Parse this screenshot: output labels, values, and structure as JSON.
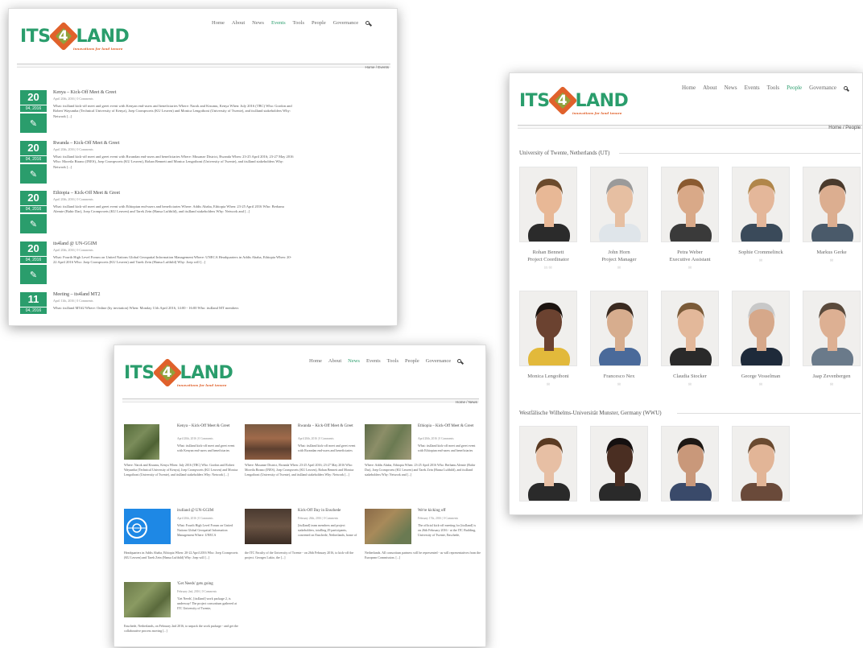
{
  "colors": {
    "brand_green": "#2a9d6c",
    "brand_orange": "#e0612b",
    "date_box": "#2a9d6c"
  },
  "brand": {
    "its": "ITS",
    "four": "4",
    "land": "LAND",
    "tagline": "innovations for land tenure"
  },
  "events_window": {
    "nav": [
      "Home",
      "About",
      "News",
      "Events",
      "Tools",
      "People",
      "Governance"
    ],
    "active": "Events",
    "breadcrumb": "Home / Events",
    "posts": [
      {
        "day": "20",
        "month": "04, 2016",
        "title": "Kenya – Kick-Off Meet & Greet",
        "meta": "April 20th, 2016 | 0 Comments",
        "body": "What: its4land kick-off meet and greet event with Kenyan end-users and beneficiaries Where: Narok and Kisumu, Kenya When: July 2016 (TBC) Who: Gordon and Robert Wayumba (Technical University of Kenya), Joep Crompvoets (KU Leuven) and Monica Lengoiboni (University of Twente), and its4land stakeholders Why: Network [...]"
      },
      {
        "day": "20",
        "month": "04, 2016",
        "title": "Rwanda – Kick-Off Meet & Greet",
        "meta": "April 20th, 2016 | 0 Comments",
        "body": "What: its4land kick-off meet and greet event with Rwandan end-users and beneficiaries Where: Musanze District, Rwanda When: 23-25 April 2016; 23-27 May 2016 Who: Moreila Birano (INES), Joep Crompvoets (KU Leuven), Rohan Bennett and Monica Lengoiboni (University of Twente), and its4land stakeholders Why: Network [...]"
      },
      {
        "day": "20",
        "month": "04, 2016",
        "title": "Ethiopia – Kick-Off Meet & Greet",
        "meta": "April 20th, 2016 | 0 Comments",
        "body": "What: its4land kick-off meet and greet event with Ethiopian end-users and beneficiaries Where: Addis Ababa, Ethiopia When: 23-25 April 2016 Who: Berhanu Alemie (Bahir Dar), Joep Crompvoets (KU Leuven) and Tarek Zein (Hansa Luftbild), and its4land stakeholders Why: Network and [...]"
      },
      {
        "day": "20",
        "month": "04, 2016",
        "title": "its4land @ UN-GGIM",
        "meta": "April 20th, 2016 | 0 Comments",
        "body": "What: Fourth High Level Forum on United Nations Global Geospatial Information Management Where: UNECA Headquarters in Addis Ababa, Ethiopia When: 20-22 April 2016 Who: Joep Crompvoets (KU Leuven) and Tarek Zein (Hansa Luftbild) Why: Joep will [...]"
      },
      {
        "day": "11",
        "month": "04, 2016",
        "title": "Meeting – its4land MT2",
        "meta": "April 11th, 2016 | 0 Comments",
        "body": "What: its4land MT#2 Where: Online (by invitation) When: Monday 11th April 2016, 14:00 - 16:00 Who: its4land MT members"
      }
    ]
  },
  "news_window": {
    "nav": [
      "Home",
      "About",
      "News",
      "Events",
      "Tools",
      "People",
      "Governance"
    ],
    "active": "News",
    "breadcrumb": "Home / News",
    "posts": [
      {
        "title": "Kenya – Kick-Off Meet & Greet",
        "meta": "April 20th, 2016 | 0 Comments",
        "side": "What: its4land kick-off meet and greet event with Kenyan end-users and beneficiaries",
        "body": "Where: Narok and Kisumu, Kenya When: July 2016 (TBC) Who: Gordon and Robert Wayumba (Technical University of Kenya), Joep Crompvoets (KU Leuven) and Monica Lengoiboni (University of Twente), and its4land stakeholders Why: Network [...]"
      },
      {
        "title": "Rwanda – Kick-Off Meet & Greet",
        "meta": "April 20th, 2016 | 0 Comments",
        "side": "What: its4land kick-off meet and greet event with Rwandan end-users and beneficiaries",
        "body": "Where: Musanze District, Rwanda When: 23-25 April 2016; 23-27 May 2016 Who: Moreila Birano (INES), Joep Crompvoets (KU Leuven), Rohan Bennett and Monica Lengoiboni (University of Twente), and its4land stakeholders Why: Network [...]"
      },
      {
        "title": "Ethiopia – Kick-Off Meet & Greet",
        "meta": "April 20th, 2016 | 0 Comments",
        "side": "What: its4land kick-off meet and greet event with Ethiopian end-users and beneficiaries",
        "body": "Where: Addis Ababa, Ethiopia When: 23-25 April 2016 Who: Berhanu Alemie (Bahir Dar), Joep Crompvoets (KU Leuven) and Tarek Zein (Hansa Luftbild), and its4land stakeholders Why: Network and [...]"
      },
      {
        "title": "its4land @ UN-GGIM",
        "meta": "April 20th, 2016 | 0 Comments",
        "side": "What: Fourth High Level Forum on United Nations Global Geospatial Information Management Where: UNECA",
        "body": "Headquarters in Addis Ababa, Ethiopia When: 20-22 April 2016 Who: Joep Crompvoets (KU Leuven) and Tarek Zein (Hansa Luftbild) Why: Joep will [...]"
      },
      {
        "title": "Kick-Off Day in Enschede",
        "meta": "February 26th, 2016 | 0 Comments",
        "side": "[its4land] team members and project stakeholders, totalling 29 participants, convened on Enschede, Netherlands, home of",
        "body": "the ITC Faculty of the University of Twente - on 26th February 2016, to kick-off the project. Georges Lukio, the [...]"
      },
      {
        "title": "We're kicking off",
        "meta": "February 17th, 2016 | 0 Comments",
        "side": "The official kick-off meeting for [its4land] is on 26th February 2016 - at the ITC Building, University of Twente, Enschede,",
        "body": "Netherlands. All consortium partners will be represented - as will representatives from the European Commission. [...]"
      },
      {
        "title": "'Get Needs' gets going",
        "meta": "February 2nd, 2016 | 0 Comments",
        "side": "'Get Needs', [its4land] work package 2, is underway! The project consortium gathered at ITC University of Twente,",
        "body": "Enschede, Netherlands, on February 2nd 2016, to unpack the work package - and get the collaborative process moving [...]"
      }
    ]
  },
  "people_window": {
    "nav": [
      "Home",
      "About",
      "News",
      "Events",
      "Tools",
      "People",
      "Governance"
    ],
    "active": "People",
    "breadcrumb": "Home / People",
    "section1": "University of Twente, Netherlands (UT)",
    "section2": "Westfälische Wilhelms-Universität Munster, Germany (WWU)",
    "people1": [
      {
        "name": "Rohan Bennett",
        "role": "Project Coordinator",
        "social": "in  ✉"
      },
      {
        "name": "John Horn",
        "role": "Project Manager",
        "social": "✉"
      },
      {
        "name": "Petra Weber",
        "role": "Executive Assistant",
        "social": "✉"
      },
      {
        "name": "Sophie Crommelinck",
        "role": "",
        "social": "✉"
      },
      {
        "name": "Markus Gerke",
        "role": "",
        "social": "✉"
      },
      {
        "name": "Monica Lengoiboni",
        "role": "",
        "social": "✉"
      },
      {
        "name": "Francesco Nex",
        "role": "",
        "social": "✉"
      },
      {
        "name": "Claudia Stocker",
        "role": "",
        "social": "✉"
      },
      {
        "name": "George Vosselman",
        "role": "",
        "social": "✉"
      },
      {
        "name": "Jaap Zevenbergen",
        "role": "",
        "social": "✉"
      }
    ],
    "people2_count": 4
  },
  "icons": {
    "search": "search-icon",
    "pencil": "pencil-icon",
    "linkedin": "linkedin-icon",
    "mail": "mail-icon"
  }
}
